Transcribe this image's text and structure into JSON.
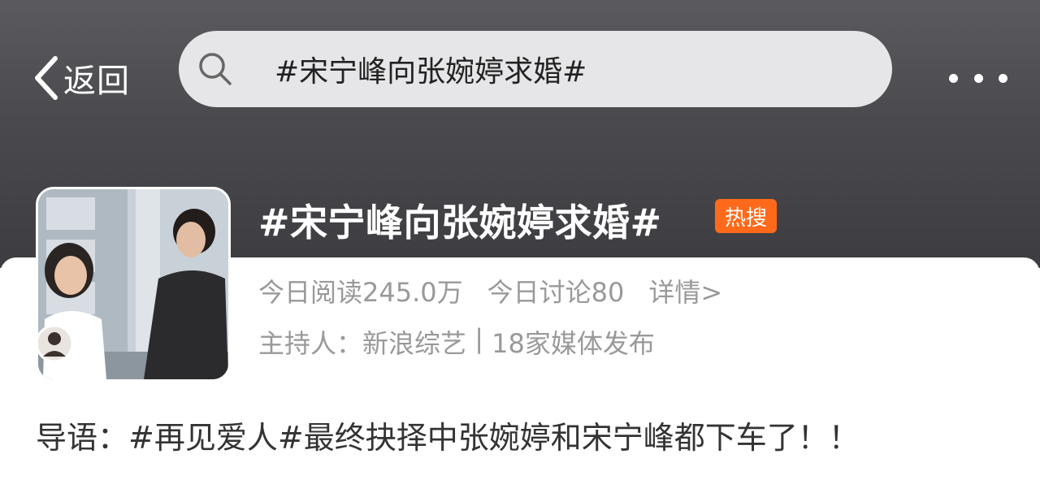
{
  "nav": {
    "back_label": "返回",
    "search_query": "#宋宁峰向张婉婷求婚#"
  },
  "topic": {
    "title": "#宋宁峰向张婉婷求婚#",
    "badge": "热搜",
    "read_label": "今日阅读245.0万",
    "discuss_label": "今日讨论80",
    "detail_link": "详情>",
    "host_prefix": "主持人：",
    "host_name": "新浪综艺",
    "separator": " | ",
    "media_count": "18家媒体发布"
  },
  "intro": {
    "label": "导语：",
    "text": "#再见爱人#最终抉择中张婉婷和宋宁峰都下车了！！"
  },
  "colors": {
    "header_bg": "#4a4a4e",
    "badge": "#ff6a1a",
    "meta_text": "#999999"
  },
  "icons": [
    "chevron-left-icon",
    "search-icon",
    "more-icon"
  ]
}
